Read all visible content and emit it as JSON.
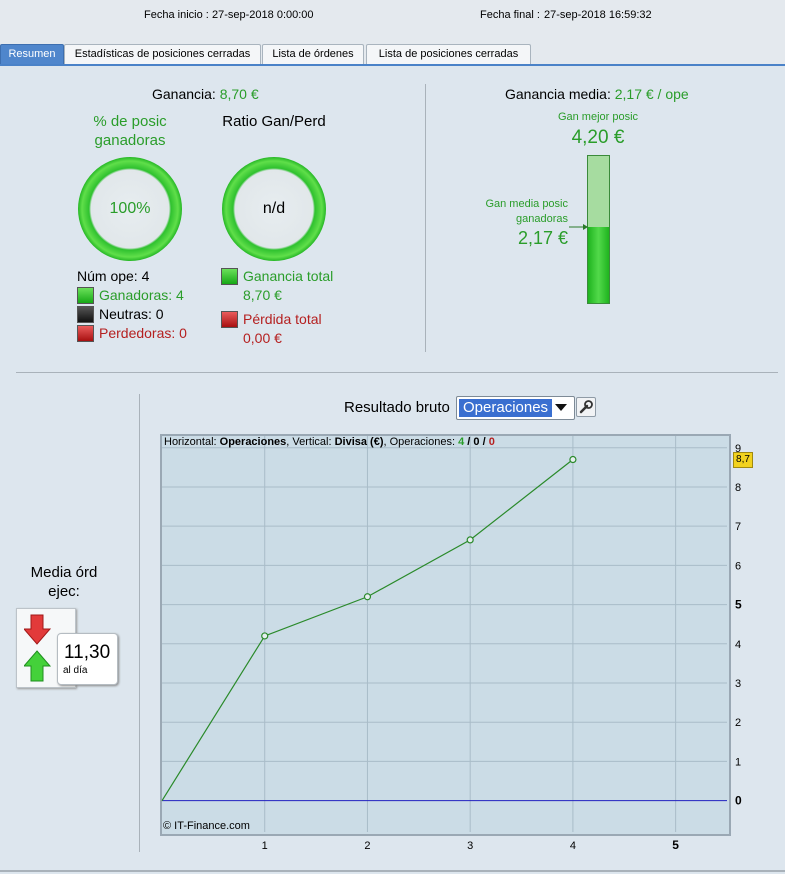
{
  "header": {
    "start_label": "Fecha inicio :",
    "start_value": "27-sep-2018 0:00:00",
    "end_label": "Fecha final :",
    "end_value": "27-sep-2018 16:59:32"
  },
  "tabs": [
    "Resumen",
    "Estadísticas de posiciones cerradas",
    "Lista de órdenes",
    "Lista de posiciones cerradas"
  ],
  "summary": {
    "profit_label": "Ganancia:",
    "profit_value": "8,70 €",
    "pct_title": "% de posic ganadoras",
    "pct_value": "100%",
    "ratio_title": "Ratio Gan/Perd",
    "ratio_value": "n/d",
    "num_ops": "Núm ope: 4",
    "winners": "Ganadoras: 4",
    "neutral": "Neutras: 0",
    "losers": "Perdedoras: 0",
    "total_gain_label": "Ganancia total",
    "total_gain_value": "8,70 €",
    "total_loss_label": "Pérdida total",
    "total_loss_value": "0,00 €"
  },
  "avg": {
    "label": "Ganancia media:",
    "value": "2,17 € / ope",
    "best_label": "Gan mejor posic",
    "best_value": "4,20 €",
    "avg_win_label": "Gan media posic ganadoras",
    "avg_win_value": "2,17 €",
    "bar_fill": 0.517
  },
  "orders": {
    "label": "Media órd ejec:",
    "value": "11,30",
    "unit": "al día"
  },
  "chart_header": {
    "label": "Resultado bruto",
    "select_value": "Operaciones"
  },
  "chart_data": {
    "type": "line",
    "x": [
      0,
      1,
      2,
      3,
      4
    ],
    "y": [
      0,
      4.2,
      5.2,
      6.65,
      8.7
    ],
    "xlim": [
      0,
      5.5
    ],
    "ylim": [
      -0.8,
      9.3
    ],
    "x_ticks": [
      "1",
      "2",
      "3",
      "4",
      "5"
    ],
    "y_ticks": [
      "0",
      "1",
      "2",
      "3",
      "4",
      "5",
      "6",
      "7",
      "8",
      "9"
    ],
    "last_value_label": "8,7",
    "info_parts": [
      "Horizontal: ",
      "Operaciones",
      ", Vertical: ",
      "Divisa (€)",
      ", Operaciones: ",
      "4",
      " / ",
      "0",
      " / ",
      "0"
    ],
    "watermark": "© IT-Finance.com",
    "line_color": "#2a8a2a",
    "zero_line_color": "#2020c0"
  }
}
